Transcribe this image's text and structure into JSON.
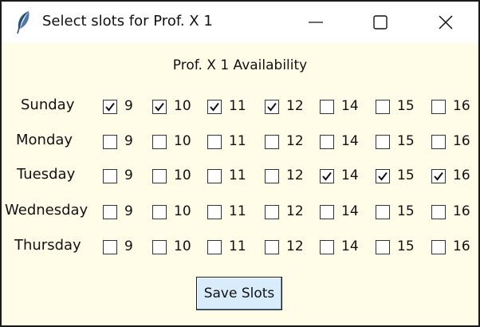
{
  "window": {
    "title": "Select slots for Prof. X 1",
    "icon": "feather-icon",
    "controls": [
      "minimize-icon",
      "maximize-icon",
      "close-icon"
    ]
  },
  "heading": "Prof. X 1 Availability",
  "slots": [
    "9",
    "10",
    "11",
    "12",
    "14",
    "15",
    "16"
  ],
  "days": [
    {
      "label": "Sunday",
      "checked": [
        true,
        true,
        true,
        true,
        false,
        false,
        false
      ]
    },
    {
      "label": "Monday",
      "checked": [
        false,
        false,
        false,
        false,
        false,
        false,
        false
      ]
    },
    {
      "label": "Tuesday",
      "checked": [
        false,
        false,
        false,
        false,
        true,
        true,
        true
      ]
    },
    {
      "label": "Wednesday",
      "checked": [
        false,
        false,
        false,
        false,
        false,
        false,
        false
      ]
    },
    {
      "label": "Thursday",
      "checked": [
        false,
        false,
        false,
        false,
        false,
        false,
        false
      ]
    }
  ],
  "save_button": "Save Slots",
  "colors": {
    "background": "#fffde8",
    "button": "#d8ecfb"
  }
}
